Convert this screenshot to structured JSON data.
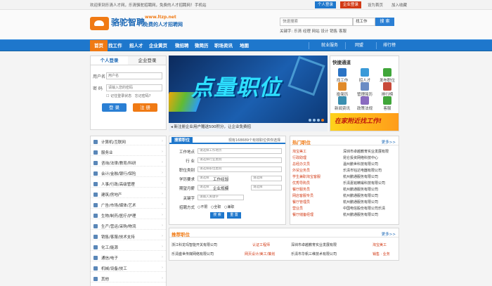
{
  "topbar": {
    "welcome": "欢迎来到乐清人才网，乐清骆驼招聘网，免费的人才招聘网！",
    "mobile": "手机站",
    "personal_login": "个人登录",
    "company_login": "企业登录",
    "links": [
      "设为首页",
      "加入收藏"
    ]
  },
  "logo": {
    "name": "骆驼智聘",
    "url": "www.ltzp.net",
    "slogan": "免费的人才招聘网"
  },
  "search": {
    "placeholder": "快速搜索",
    "type": "找工作",
    "button": "搜 索",
    "keywords_label": "关键字:",
    "keywords": [
      "乐清",
      "经理",
      "网站",
      "设计",
      "销售",
      "客服"
    ]
  },
  "nav": {
    "items": [
      "首页",
      "找工作",
      "招人才",
      "企业黄页",
      "微招聘",
      "微简历",
      "职场资讯",
      "地图"
    ],
    "sub": [
      "就业服务",
      "网盟",
      "排行榜"
    ]
  },
  "login": {
    "tabs": [
      "个人登录",
      "企业登录"
    ],
    "username_label": "用户名",
    "username_placeholder": "用户名",
    "password_label": "密 码",
    "password_placeholder": "请输入您的密码",
    "remember": "记住登录状态",
    "forgot": "忘记密码?",
    "login_btn": "登 录",
    "register_btn": "注 册"
  },
  "banner": {
    "headline": "点量职位",
    "caption": "新注册企业用户赠送500积分，让企业免费招"
  },
  "quick": {
    "title": "快捷通道",
    "items": [
      "找工作",
      "招人才",
      "发布职位",
      "投简历",
      "管理简历",
      "排行榜",
      "新闻资讯",
      "政策法规",
      "客服"
    ],
    "ad": "在家附近找工作!"
  },
  "categories": [
    "计算机/互联网",
    "服务业",
    "咨询/法律/教育/科研",
    "会计/金融/银行/保险",
    "人事/行政/高级管理",
    "建筑/房地产",
    "广告/市场/媒体/艺术",
    "生物/制药/医疗/护理",
    "生产/营运/采购/物流",
    "销售/客服/技术支持",
    "化工/能源",
    "通信/电子",
    "机械/设备/技工",
    "其他"
  ],
  "form": {
    "tab": "搜索职位",
    "stat": "现有168689个有效职位供你选择",
    "fields": {
      "location": "工作地点",
      "industry": "行 业",
      "category": "职位类别",
      "education": "学历要求",
      "experience": "工作经验",
      "salary": "期望月薪",
      "scale": "企业规模",
      "keyword": "关键字",
      "mode": "招聘方式"
    },
    "placeholders": {
      "location": "请选择工作地点",
      "industry": "请选择行业类别",
      "category": "请选择职位类别",
      "generic": "请选择",
      "keyword": "请输入关键字"
    },
    "modes": [
      "不限",
      "全职",
      "兼职"
    ],
    "buttons": [
      "搜 索",
      "重 置"
    ]
  },
  "hot": {
    "title": "热门职位",
    "more": "更多>>",
    "rows": [
      {
        "job": "淘宝美工",
        "company": "深圳市卓越教育实业发展有限"
      },
      {
        "job": "行政助理",
        "company": "昆仑投资网络科技中心"
      },
      {
        "job": "总经办文员",
        "company": "温州鹏世科技有限公司"
      },
      {
        "job": "外贸业务员",
        "company": "乐清市钰达电器有限公司"
      },
      {
        "job": "学生兼职淘宝客服",
        "company": "杭州鹏通服务有限公司"
      },
      {
        "job": "优秀导购员",
        "company": "乐清嘉铭精锻科技有限公司"
      },
      {
        "job": "餐厅服务员",
        "company": "杭州鹏通服务有限公司"
      },
      {
        "job": "网店客服专员",
        "company": "杭州鹏通服务有限公司"
      },
      {
        "job": "餐厅管理员",
        "company": "杭州鹏通服务有限公司"
      },
      {
        "job": "营业员",
        "company": "中国电信股份有限公司乐清"
      },
      {
        "job": "餐厅储备经理",
        "company": "杭州鹏通服务有限公司"
      }
    ]
  },
  "recommend": {
    "title": "推荐职位",
    "more": "更多>>",
    "rows": [
      {
        "company": "浙江科龙玛智能开关有限公司",
        "job": "认证工程师",
        "company2": "深圳市卓越教育实业发展有限",
        "job2": "淘宝美工"
      },
      {
        "company": "乐清盛世传媒网络有限公司",
        "job": "网页设计/美工/策划",
        "company2": "乐清市华帆三维技术有限公司",
        "job2": "销售 · 业务"
      }
    ]
  },
  "colors": {
    "brand_blue": "#1e77cc",
    "accent_orange": "#f07a14",
    "red": "#d23a15"
  }
}
